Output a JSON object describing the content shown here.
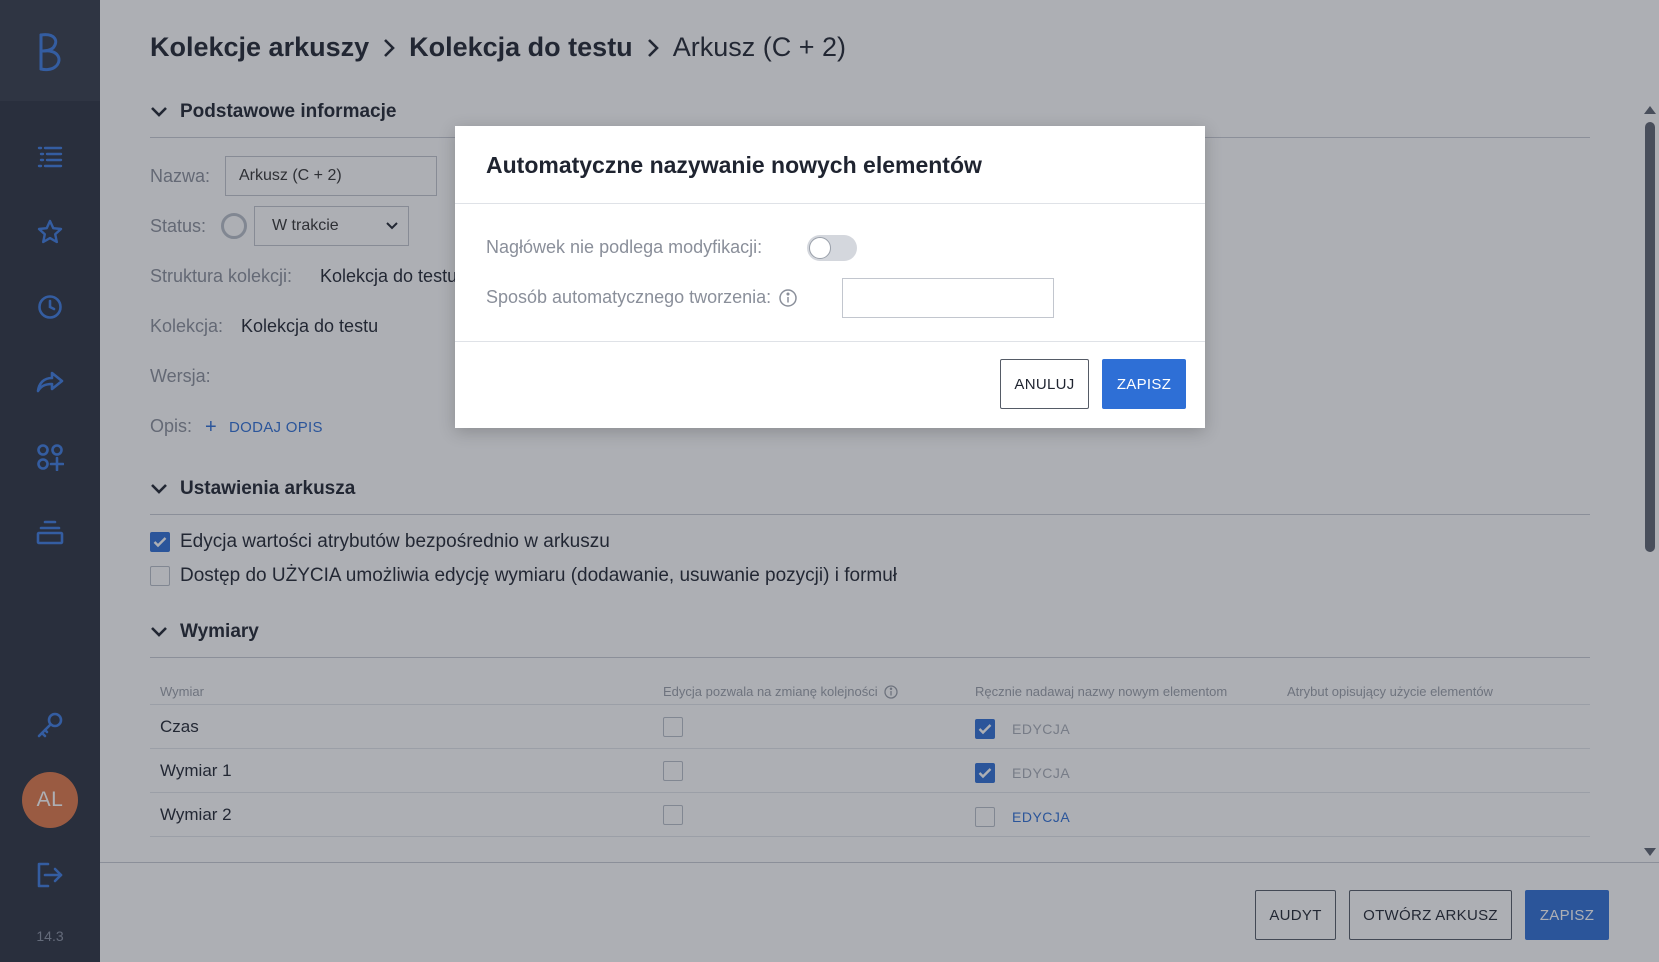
{
  "app": {
    "version": "14.3",
    "avatar_initials": "AL",
    "accent_color": "#2e6fd6",
    "sidebar_color": "#2b3140",
    "nav_icons": [
      "list-icon",
      "star-icon",
      "clock-icon",
      "share-icon",
      "apps-add-icon",
      "stack-icon",
      "key-icon",
      "logout-icon"
    ]
  },
  "breadcrumb": {
    "items": [
      "Kolekcje arkuszy",
      "Kolekcja do testu",
      "Arkusz (C + 2)"
    ]
  },
  "basic_info": {
    "title": "Podstawowe informacje",
    "name_label": "Nazwa:",
    "name_value": "Arkusz (C + 2)",
    "status_label": "Status:",
    "status_value": "W trakcie",
    "structure_label": "Struktura kolekcji:",
    "structure_value": "Kolekcja do testu",
    "collection_label": "Kolekcja:",
    "collection_value": "Kolekcja do testu",
    "version_label": "Wersja:",
    "description_label": "Opis:",
    "add_description": "DODAJ OPIS"
  },
  "sheet_settings": {
    "title": "Ustawienia arkusza",
    "options": [
      {
        "label": "Edycja wartości atrybutów bezpośrednio w arkuszu",
        "checked": true
      },
      {
        "label": "Dostęp do UŻYCIA umożliwia edycję wymiaru (dodawanie, usuwanie pozycji) i formuł",
        "checked": false
      }
    ]
  },
  "dimensions": {
    "title": "Wymiary",
    "headers": [
      "Wymiar",
      "Edycja pozwala na zmianę kolejności",
      "Ręcznie nadawaj nazwy nowym elementom",
      "Atrybut opisujący użycie elementów"
    ],
    "rows": [
      {
        "name": "Czas",
        "reorder": false,
        "manual_naming": true,
        "edit_label": "EDYCJA",
        "edit_active": false
      },
      {
        "name": "Wymiar 1",
        "reorder": false,
        "manual_naming": true,
        "edit_label": "EDYCJA",
        "edit_active": false
      },
      {
        "name": "Wymiar 2",
        "reorder": false,
        "manual_naming": false,
        "edit_label": "EDYCJA",
        "edit_active": true
      }
    ]
  },
  "footer": {
    "audit": "AUDYT",
    "open_sheet": "OTWÓRZ ARKUSZ",
    "save": "ZAPISZ"
  },
  "modal": {
    "title": "Automatyczne nazywanie nowych elementów",
    "header_label": "Nagłówek nie podlega modyfikacji:",
    "header_toggle_on": false,
    "method_label": "Sposób automatycznego tworzenia:",
    "method_value": "",
    "cancel": "ANULUJ",
    "save": "ZAPISZ"
  }
}
